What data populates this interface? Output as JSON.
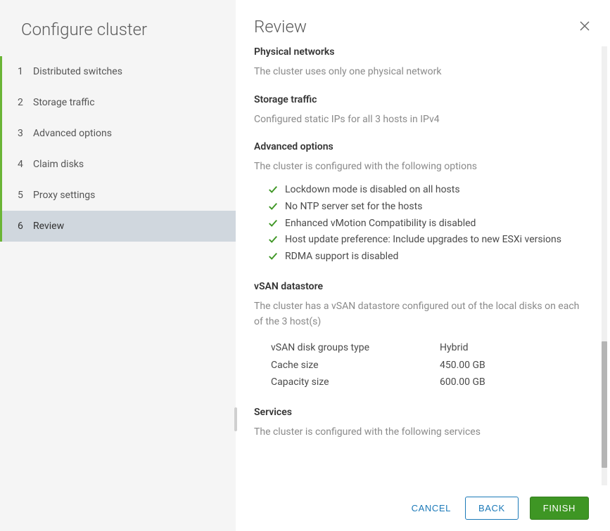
{
  "sidebar": {
    "title": "Configure cluster",
    "steps": [
      {
        "num": "1",
        "label": "Distributed switches",
        "active": false
      },
      {
        "num": "2",
        "label": "Storage traffic",
        "active": false
      },
      {
        "num": "3",
        "label": "Advanced options",
        "active": false
      },
      {
        "num": "4",
        "label": "Claim disks",
        "active": false
      },
      {
        "num": "5",
        "label": "Proxy settings",
        "active": false
      },
      {
        "num": "6",
        "label": "Review",
        "active": true
      }
    ]
  },
  "main": {
    "title": "Review"
  },
  "sections": {
    "physical": {
      "title": "Physical networks",
      "desc": "The cluster uses only one physical network"
    },
    "storage": {
      "title": "Storage traffic",
      "desc": "Configured static IPs for all 3 hosts in IPv4"
    },
    "advanced": {
      "title": "Advanced options",
      "desc": "The cluster is configured with the following options",
      "options": [
        "Lockdown mode is disabled on all hosts",
        "No NTP server set for the hosts",
        "Enhanced vMotion Compatibility is disabled",
        "Host update preference: Include upgrades to new ESXi versions",
        "RDMA support is disabled"
      ]
    },
    "vsan": {
      "title": "vSAN datastore",
      "desc": "The cluster has a vSAN datastore configured out of the local disks on each of the 3 host(s)",
      "rows": [
        {
          "label": "vSAN disk groups type",
          "value": "Hybrid"
        },
        {
          "label": "Cache size",
          "value": "450.00 GB"
        },
        {
          "label": "Capacity size",
          "value": "600.00 GB"
        }
      ]
    },
    "services": {
      "title": "Services",
      "desc": "The cluster is configured with the following services"
    }
  },
  "footer": {
    "cancel": "CANCEL",
    "back": "BACK",
    "finish": "FINISH"
  }
}
